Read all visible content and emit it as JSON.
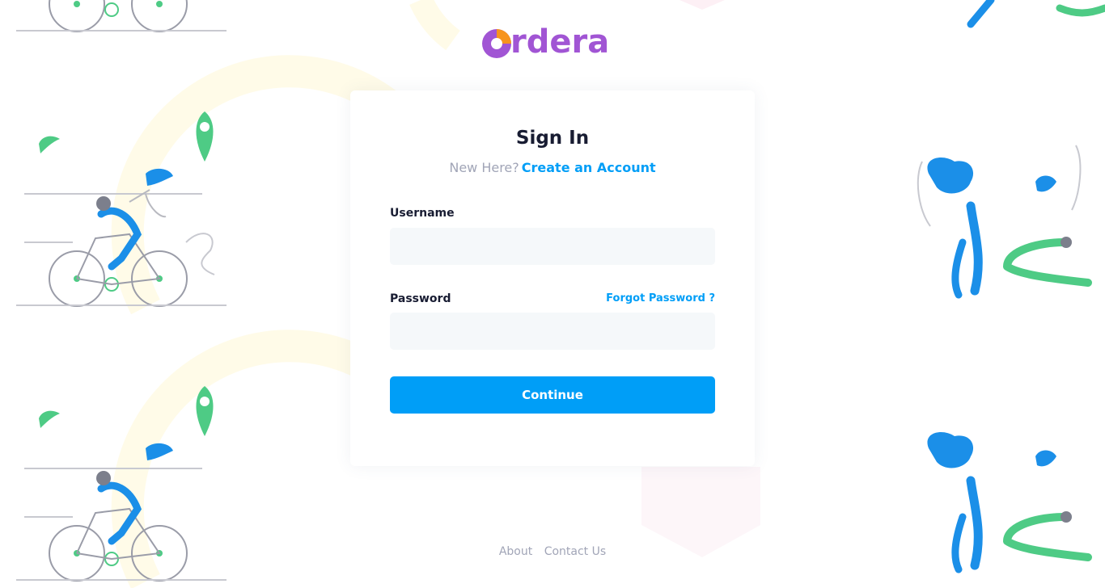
{
  "brand": {
    "name": "rdera",
    "color": "#a155d4"
  },
  "card": {
    "title": "Sign In",
    "subtitle_text": "New Here?",
    "create_account_link": "Create an Account"
  },
  "form": {
    "username_label": "Username",
    "username_value": "",
    "password_label": "Password",
    "password_value": "",
    "forgot_link": "Forgot Password ?",
    "continue_label": "Continue"
  },
  "footer": {
    "about": "About",
    "contact": "Contact Us"
  },
  "colors": {
    "primary": "#009ef7",
    "input_bg": "#f5f8fa",
    "title": "#181c32",
    "muted": "#a1a5b7"
  }
}
